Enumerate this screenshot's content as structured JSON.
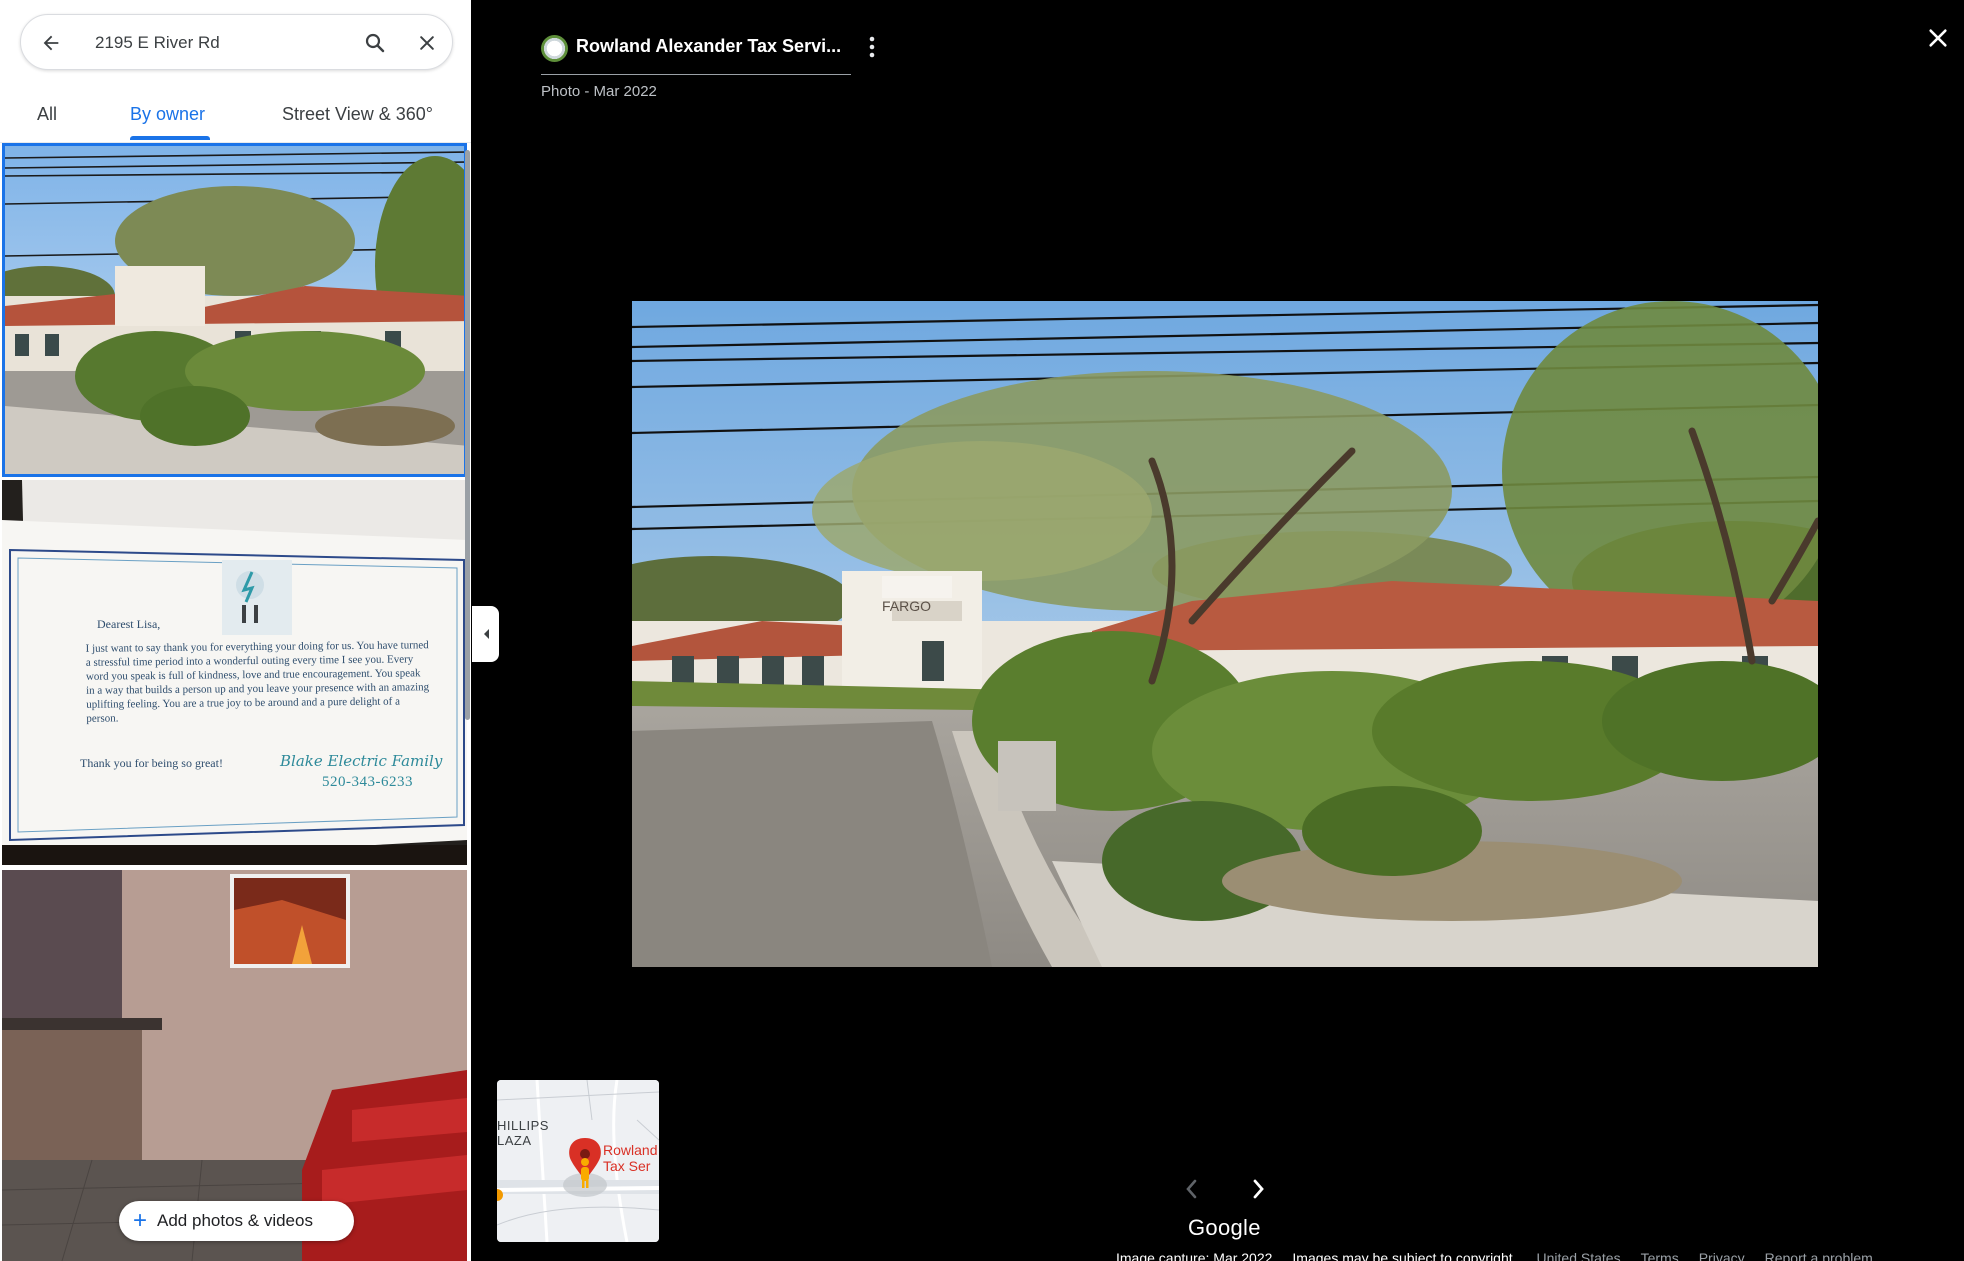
{
  "search": {
    "query": "2195 E River Rd"
  },
  "tabs": [
    {
      "label": "All"
    },
    {
      "label": "By owner"
    },
    {
      "label": "Street View & 360°"
    }
  ],
  "active_tab": "By owner",
  "thumbnails": {
    "card": {
      "greeting": "Dearest Lisa,",
      "body": "I just want to say thank you for everything your doing for us. You have turned a stressful time period into a wonderful outing every time I see you. Every word you speak is full of kindness, love and true encouragement. You speak in a way that builds a person up and you leave your presence with an amazing uplifting feeling. You are a true joy to be around and a pure delight of a person.",
      "thanks": "Thank you for being so great!",
      "signature": "Blake Electric Family",
      "phone": "520-343-6233"
    }
  },
  "add_button": {
    "label": "Add photos & videos"
  },
  "viewer": {
    "title": "Rowland Alexander Tax Servi...",
    "subtitle": "Photo - Mar 2022",
    "building_sign": "FARGO"
  },
  "minimap": {
    "area_label_line1": "HILLIPS",
    "area_label_line2": "LAZA",
    "place_line1": "Rowland",
    "place_line2": "Tax Ser"
  },
  "brand": "Google",
  "footer": {
    "image_capture": "Image capture: Mar 2022",
    "copyright": "Images may be subject to copyright.",
    "country": "United States",
    "terms": "Terms",
    "privacy": "Privacy",
    "report": "Report a problem"
  },
  "colors": {
    "accent": "#1a73e8",
    "viewer_bg": "#000000",
    "pin": "#d93025"
  },
  "icons": [
    "arrow-back-icon",
    "search-icon",
    "close-icon",
    "more-vert-icon",
    "chevron-left-icon",
    "chevron-right-icon",
    "plus-icon",
    "map-pin-icon",
    "pegman-icon"
  ]
}
